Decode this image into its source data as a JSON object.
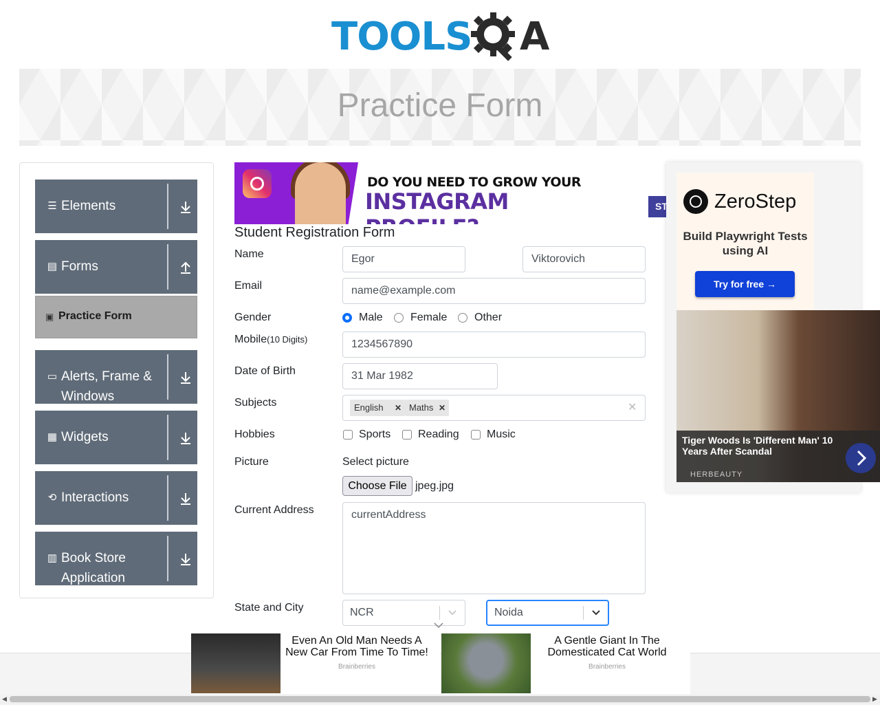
{
  "header": {
    "logo_text_1": "TOOLS",
    "logo_text_2": "A",
    "page_title": "Practice Form"
  },
  "sidebar": {
    "groups": [
      {
        "label": "Elements",
        "icon": "menu-icon",
        "arrow": "download-icon"
      },
      {
        "label": "Forms",
        "icon": "document-icon",
        "arrow": "upload-icon"
      },
      {
        "label": "Alerts, Frame & Windows",
        "icon": "window-icon",
        "arrow": "download-icon"
      },
      {
        "label": "Widgets",
        "icon": "widgets-icon",
        "arrow": "download-icon"
      },
      {
        "label": "Interactions",
        "icon": "interactions-icon",
        "arrow": "download-icon"
      },
      {
        "label": "Book Store Application",
        "icon": "books-icon",
        "arrow": "download-icon"
      }
    ],
    "active_subitem": "Practice Form"
  },
  "ad_top": {
    "line1": "DO YOU NEED TO GROW YOUR",
    "line2": "INSTAGRAM PROFILE?",
    "tag": "ST"
  },
  "form": {
    "title": "Student Registration Form",
    "name_label": "Name",
    "first_name": "Egor",
    "last_name": "Viktorovich",
    "email_label": "Email",
    "email_placeholder": "name@example.com",
    "gender_label": "Gender",
    "genders": [
      "Male",
      "Female",
      "Other"
    ],
    "gender_selected": "Male",
    "mobile_label": "Mobile",
    "mobile_hint": "(10 Digits)",
    "mobile": "1234567890",
    "dob_label": "Date of Birth",
    "dob": "31 Mar 1982",
    "subjects_label": "Subjects",
    "subjects": [
      "English",
      "Maths"
    ],
    "hobbies_label": "Hobbies",
    "hobbies": [
      "Sports",
      "Reading",
      "Music"
    ],
    "picture_label": "Picture",
    "select_picture": "Select picture",
    "choose_file": "Choose File",
    "file_name": "jpeg.jpg",
    "address_label": "Current Address",
    "address_placeholder": "currentAddress",
    "state_city_label": "State and City",
    "state": "NCR",
    "city": "Noida"
  },
  "ad_right": {
    "brand": "ZeroStep",
    "subtitle": "Build Playwright Tests using AI",
    "cta": "Try for free →",
    "headline": "Tiger Woods Is 'Different Man' 10 Years After Scandal",
    "source": "HERBEAUTY"
  },
  "ads_bottom": [
    {
      "title": "Even An Old Man Needs A New Car From Time To Time!",
      "source": "Brainberries"
    },
    {
      "title": "A Gentle Giant In The Domesticated Cat World",
      "source": "Brainberries"
    }
  ],
  "colors": {
    "logo_blue": "#1a8fd1",
    "sidebar_bg": "#5f6b78",
    "accent": "#0d6efd",
    "active_item": "#a9a9a9"
  }
}
